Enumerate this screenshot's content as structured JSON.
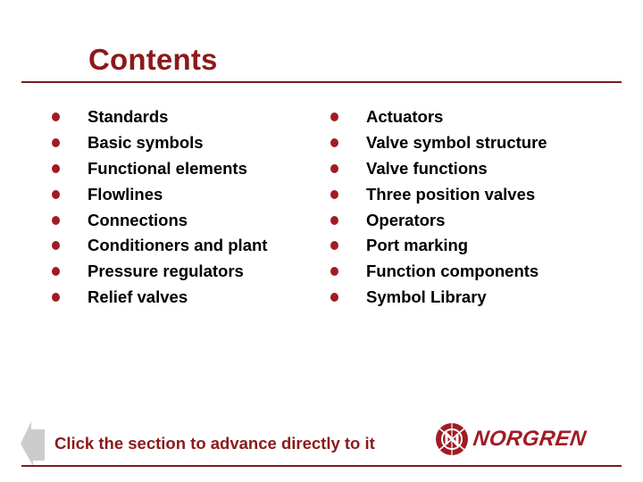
{
  "title": "Contents",
  "left_items": [
    {
      "label": "Standards"
    },
    {
      "label": "Basic symbols"
    },
    {
      "label": "Functional elements"
    },
    {
      "label": "Flowlines"
    },
    {
      "label": "Connections"
    },
    {
      "label": "Conditioners and plant"
    },
    {
      "label": "Pressure regulators"
    },
    {
      "label": "Relief valves"
    }
  ],
  "right_items": [
    {
      "label": "Actuators"
    },
    {
      "label": "Valve symbol structure"
    },
    {
      "label": "Valve functions"
    },
    {
      "label": "Three position valves"
    },
    {
      "label": "Operators"
    },
    {
      "label": "Port marking"
    },
    {
      "label": "Function components"
    },
    {
      "label": "Symbol Library"
    }
  ],
  "footer": {
    "instruction": "Click the section to advance directly to it",
    "back_icon": "left-arrow-icon"
  },
  "logo": {
    "text": "NORGREN",
    "icon": "globe-logo-icon"
  },
  "colors": {
    "accent": "#8b1a1a",
    "bullet": "#a01c24",
    "rule": "#7a1e22",
    "arrow": "#cccccc"
  }
}
